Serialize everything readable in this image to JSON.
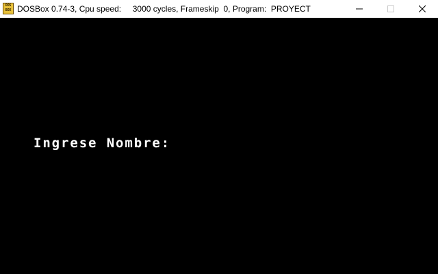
{
  "window": {
    "title": "DOSBox 0.74-3, Cpu speed:     3000 cycles, Frameskip  0, Program:  PROYECT",
    "icon": {
      "name": "dosbox-icon",
      "text_top": "DOS",
      "text_bottom": "BOX"
    },
    "controls": {
      "minimize": "minimize-icon",
      "maximize": "maximize-icon",
      "close": "close-icon"
    }
  },
  "screen": {
    "background": "#000000",
    "text_color": "#ffffff",
    "prompt": "Ingrese Nombre:"
  }
}
